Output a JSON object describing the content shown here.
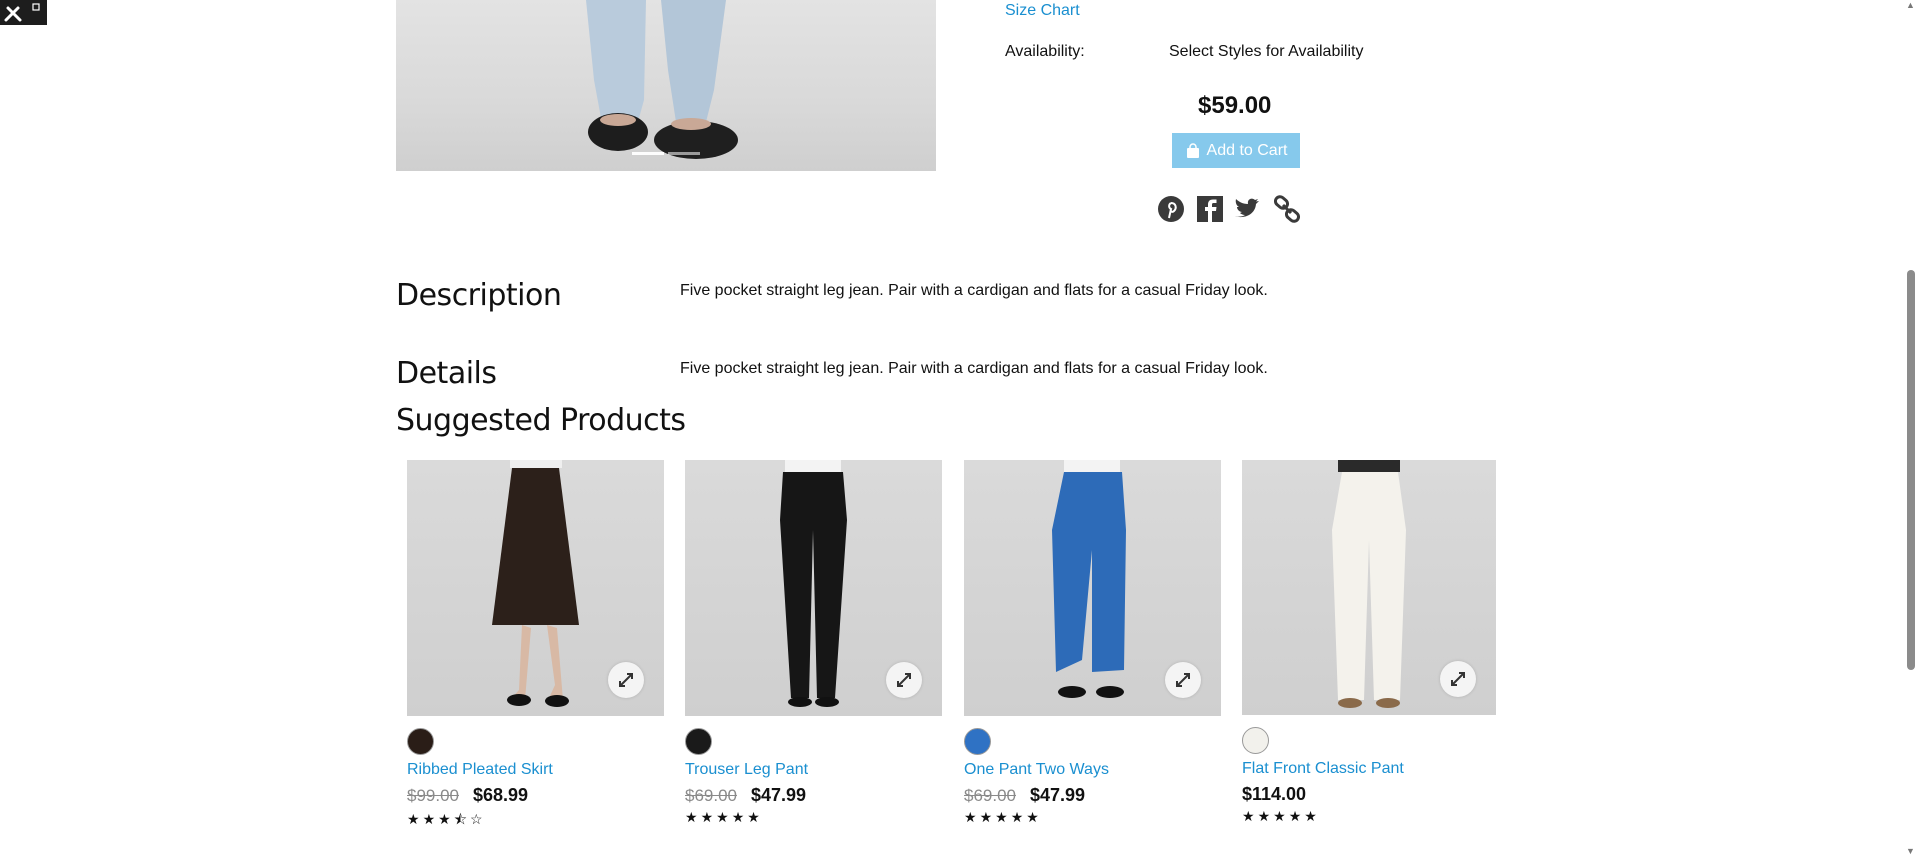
{
  "product": {
    "size_chart": "Size Chart",
    "availability_label": "Availability:",
    "availability_value": "Select Styles for Availability",
    "price": "$59.00",
    "add_to_cart": "Add to Cart",
    "share_icons": [
      "pinterest-icon",
      "facebook-icon",
      "twitter-icon",
      "link-icon"
    ],
    "carousel_slides": 2
  },
  "sections": {
    "description_title": "Description",
    "description_text": "Five pocket straight leg jean. Pair with a cardigan and flats for a casual Friday look.",
    "details_title": "Details",
    "details_text": "Five pocket straight leg jean. Pair with a cardigan and flats for a casual Friday look.",
    "suggested_title": "Suggested Products"
  },
  "suggested": [
    {
      "name": "Ribbed Pleated Skirt",
      "old_price": "$99.00",
      "price": "$68.99",
      "rating": 3.5,
      "swatch": "#2a1d17"
    },
    {
      "name": "Trouser Leg Pant",
      "old_price": "$69.00",
      "price": "$47.99",
      "rating": 5,
      "swatch": "#1a1a1a"
    },
    {
      "name": "One Pant Two Ways",
      "old_price": "$69.00",
      "price": "$47.99",
      "rating": 5,
      "swatch": "#2f72c4"
    },
    {
      "name": "Flat Front Classic Pant",
      "old_price": "",
      "price": "$114.00",
      "rating": 5,
      "swatch": "#f2f1ec"
    }
  ],
  "colors": {
    "link": "#1a8fd0",
    "cart_button": "#86c9ec"
  }
}
